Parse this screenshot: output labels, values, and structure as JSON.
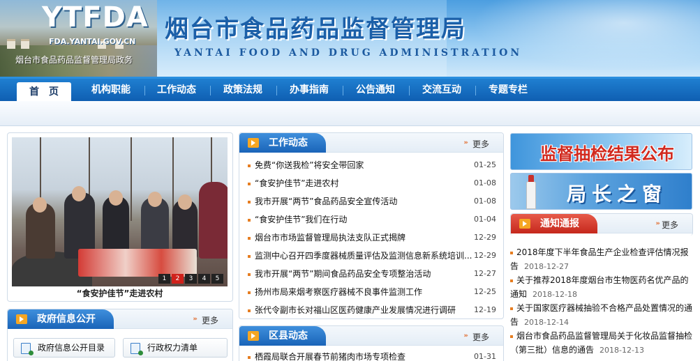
{
  "header": {
    "logo": "YTFDA",
    "domain": "FDA.YANTAI.GOV.CN",
    "caption": "烟台市食品药品监督管理局政务",
    "agency_cn": "烟台市食品药品监督管理局",
    "agency_en": "YANTAI  FOOD  AND  DRUG  ADMINISTRATION"
  },
  "nav": {
    "items": [
      {
        "label": "首　页"
      },
      {
        "label": "机构职能"
      },
      {
        "label": "工作动态"
      },
      {
        "label": "政策法规"
      },
      {
        "label": "办事指南"
      },
      {
        "label": "公告通知"
      },
      {
        "label": "交流互动"
      },
      {
        "label": "专题专栏"
      }
    ]
  },
  "carousel": {
    "caption": "“食安护佳节”走进农村",
    "pages": [
      "1",
      "2",
      "3",
      "4",
      "5"
    ],
    "active_page": "2"
  },
  "gov_info": {
    "title": "政府信息公开",
    "more": "更多",
    "buttons": [
      "政府信息公开目录",
      "行政权力清单"
    ]
  },
  "work_news": {
    "title": "工作动态",
    "more": "更多",
    "items": [
      {
        "title": "免费“你送我检”将安全带回家",
        "date": "01-25"
      },
      {
        "title": "“食安护佳节”走进农村",
        "date": "01-08"
      },
      {
        "title": "我市开展“两节”食品药品安全宣传活动",
        "date": "01-08"
      },
      {
        "title": "“食安护佳节”我们在行动",
        "date": "01-04"
      },
      {
        "title": "烟台市市场监督管理局执法支队正式揭牌",
        "date": "12-29"
      },
      {
        "title": "监测中心召开四季度器械质量评估及监测信息新系统培训...",
        "date": "12-29"
      },
      {
        "title": "我市开展“两节”期间食品药品安全专项整治活动",
        "date": "12-27"
      },
      {
        "title": "扬州市局来烟考察医疗器械不良事件监测工作",
        "date": "12-25"
      },
      {
        "title": "张代令副市长对福山区医药健康产业发展情况进行调研",
        "date": "12-19"
      }
    ]
  },
  "district_news": {
    "title": "区县动态",
    "more": "更多",
    "items": [
      {
        "title": "栖霞局联合开展春节前猪肉市场专项检查",
        "date": "01-31"
      }
    ]
  },
  "right": {
    "banner1": "监督抽检结果公布",
    "banner2": "局长之窗",
    "notice": {
      "title": "通知通报",
      "more": "更多",
      "items": [
        {
          "title": "2018年度下半年食品生产企业检查评估情况报告",
          "date": "2018-12-27"
        },
        {
          "title": "关于推荐2018年度烟台市生物医药名优产品的通知",
          "date": "2018-12-18"
        },
        {
          "title": "关于国家医疗器械抽验不合格产品处置情况的通告",
          "date": "2018-12-14"
        },
        {
          "title": "烟台市食品药品监督管理局关于化妆品监督抽检（第三批）信息的通告",
          "date": "2018-12-13"
        }
      ]
    }
  },
  "colors": {
    "nav_blue": "#0f5fb2",
    "tab_blue": "#1a64b8",
    "tab_red": "#c5281c",
    "bullet_orange": "#e67e22",
    "agency_blue": "#1b5fa8"
  }
}
